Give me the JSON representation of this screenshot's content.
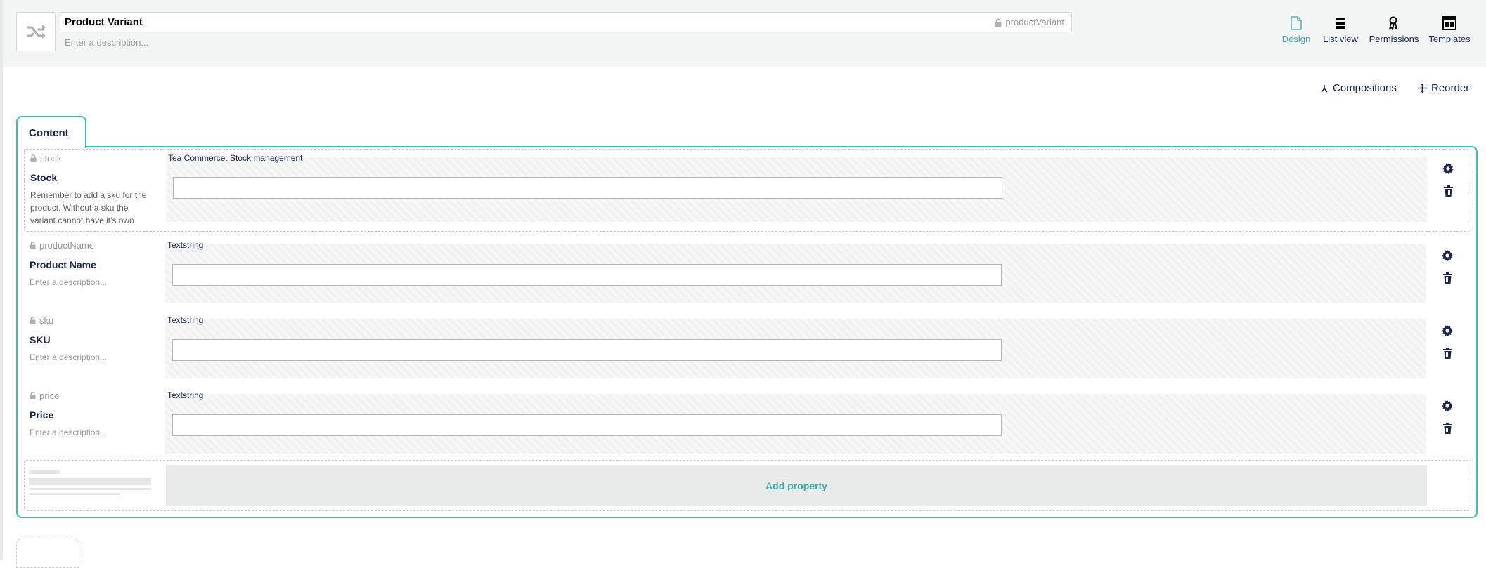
{
  "header": {
    "name": "Product Variant",
    "alias": "productVariant",
    "description_placeholder": "Enter a description..."
  },
  "app_nav": [
    {
      "label": "Design",
      "icon": "document-icon",
      "active": true
    },
    {
      "label": "List view",
      "icon": "list-icon",
      "active": false
    },
    {
      "label": "Permissions",
      "icon": "permissions-icon",
      "active": false
    },
    {
      "label": "Templates",
      "icon": "template-icon",
      "active": false
    }
  ],
  "toolbar": {
    "compositions_label": "Compositions",
    "reorder_label": "Reorder"
  },
  "tabs": [
    {
      "label": "Content"
    }
  ],
  "properties": [
    {
      "alias": "stock",
      "label": "Stock",
      "description": "Remember to add a sku for the product. Without a sku the variant cannot have it's own",
      "editor": "Tea Commerce: Stock management"
    },
    {
      "alias": "productName",
      "label": "Product Name",
      "description": "Enter a description...",
      "editor": "Textstring"
    },
    {
      "alias": "sku",
      "label": "SKU",
      "description": "Enter a description...",
      "editor": "Textstring"
    },
    {
      "alias": "price",
      "label": "Price",
      "description": "Enter a description...",
      "editor": "Textstring"
    }
  ],
  "add_property_label": "Add property",
  "colors": {
    "accent": "#3dbfb6",
    "active_nav": "#3dacaa",
    "text": "#1b264f"
  }
}
